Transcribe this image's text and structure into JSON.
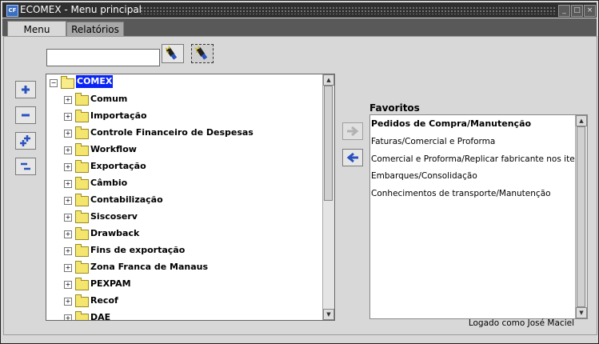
{
  "window": {
    "title": "ECOMEX - Menu principal",
    "app_icon": "app-logo-icon",
    "controls": [
      "minimize-icon",
      "maximize-icon",
      "close-icon"
    ]
  },
  "tabs": [
    {
      "label": "Menu",
      "active": true
    },
    {
      "label": "Relatórios",
      "active": false
    }
  ],
  "search": {
    "value": "",
    "placeholder": ""
  },
  "toolbar": {
    "icons": [
      "flashlight-icon",
      "flashlight-selected-icon"
    ]
  },
  "side_buttons": [
    "expand-icon",
    "collapse-icon",
    "expand-all-icon",
    "collapse-all-icon"
  ],
  "tree": {
    "root": "COMEX",
    "items": [
      "Comum",
      "Importação",
      "Controle Financeiro de Despesas",
      "Workflow",
      "Exportação",
      "Câmbio",
      "Contabilização",
      "Siscoserv",
      "Drawback",
      "Fins de exportação",
      "Zona Franca de Manaus",
      "PEXPAM",
      "Recof",
      "DAE"
    ]
  },
  "favorites": {
    "label": "Favoritos",
    "items": [
      "Pedidos de Compra/Manutenção",
      "Faturas/Comercial e Proforma",
      "Comercial e Proforma/Replicar fabricante nos itens d",
      "Embarques/Consolidação",
      "Conhecimentos de transporte/Manutenção"
    ]
  },
  "transfer_buttons": [
    "arrow-right-icon",
    "arrow-left-icon"
  ],
  "status": {
    "logged_in": "Logado como José Maciel"
  }
}
